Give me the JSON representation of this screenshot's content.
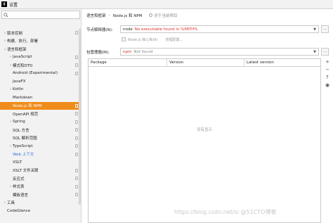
{
  "window": {
    "title": "设置",
    "app_icon": "IJ"
  },
  "sidebar": {
    "items": [
      {
        "label": "版本控制",
        "level": 0,
        "expander": "collapsed",
        "config": true
      },
      {
        "label": "构建、执行、部署",
        "level": 0,
        "expander": "collapsed",
        "config": false
      },
      {
        "label": "语言和框架",
        "level": 0,
        "expander": "expanded",
        "config": false
      },
      {
        "label": "JavaScript",
        "level": 1,
        "expander": "collapsed",
        "config": true
      },
      {
        "label": "模式和DTD",
        "level": 1,
        "expander": "collapsed",
        "config": true
      },
      {
        "label": "Android (Experimental)",
        "level": 1,
        "expander": "none",
        "config": true
      },
      {
        "label": "JavaFX",
        "level": 1,
        "expander": "none",
        "config": false
      },
      {
        "label": "Kotlin",
        "level": 1,
        "expander": "collapsed",
        "config": false
      },
      {
        "label": "Markdown",
        "level": 1,
        "expander": "none",
        "config": false
      },
      {
        "label": "Node.js 和 NPM",
        "level": 1,
        "expander": "none",
        "config": true,
        "selected": true
      },
      {
        "label": "OpenAPI 规范",
        "level": 1,
        "expander": "none",
        "config": true
      },
      {
        "label": "Spring",
        "level": 1,
        "expander": "collapsed",
        "config": true
      },
      {
        "label": "SQL 方言",
        "level": 1,
        "expander": "none",
        "config": true
      },
      {
        "label": "SQL 解析范围",
        "level": 1,
        "expander": "none",
        "config": true
      },
      {
        "label": "TypeScript",
        "level": 1,
        "expander": "collapsed",
        "config": true
      },
      {
        "label": "Web 上下文",
        "level": 1,
        "expander": "none",
        "config": true,
        "link": true
      },
      {
        "label": "XSLT",
        "level": 1,
        "expander": "none",
        "config": false
      },
      {
        "label": "XSLT 文件关联",
        "level": 1,
        "expander": "none",
        "config": true
      },
      {
        "label": "反应式",
        "level": 1,
        "expander": "none",
        "config": true
      },
      {
        "label": "样式表",
        "level": 1,
        "expander": "collapsed",
        "config": true
      },
      {
        "label": "模板语言",
        "level": 1,
        "expander": "none",
        "config": true
      },
      {
        "label": "工具",
        "level": 0,
        "expander": "collapsed",
        "config": false
      },
      {
        "label": "CodeGlance",
        "level": 0,
        "expander": "none",
        "config": false
      }
    ]
  },
  "main": {
    "breadcrumb": {
      "parent": "语言和框架",
      "separator": "›",
      "current": "Node.js 和 NPM",
      "reset_label": "对于当前项目"
    },
    "node_interpreter": {
      "label": "节点解释器(N):",
      "value": "node",
      "error": "No executable found in %PATH%",
      "browse": "..."
    },
    "checkbox": {
      "label": "Node.js 核心库(A)",
      "extra": "管理配置..."
    },
    "package_manager": {
      "label": "包管理器(M):",
      "value": "npm",
      "status": "Not found",
      "browse": "..."
    },
    "table": {
      "columns": [
        "Package",
        "Version",
        "Latest version"
      ],
      "empty_text": "没有显示",
      "tools": [
        "+",
        "−",
        "↑",
        "◉"
      ]
    }
  },
  "watermark": "https://blog.csdn.net/si @51CTO博客",
  "colors": {
    "selected_bg": "#f08c1a",
    "error_text": "#e03030",
    "link": "#3a6fd8"
  }
}
